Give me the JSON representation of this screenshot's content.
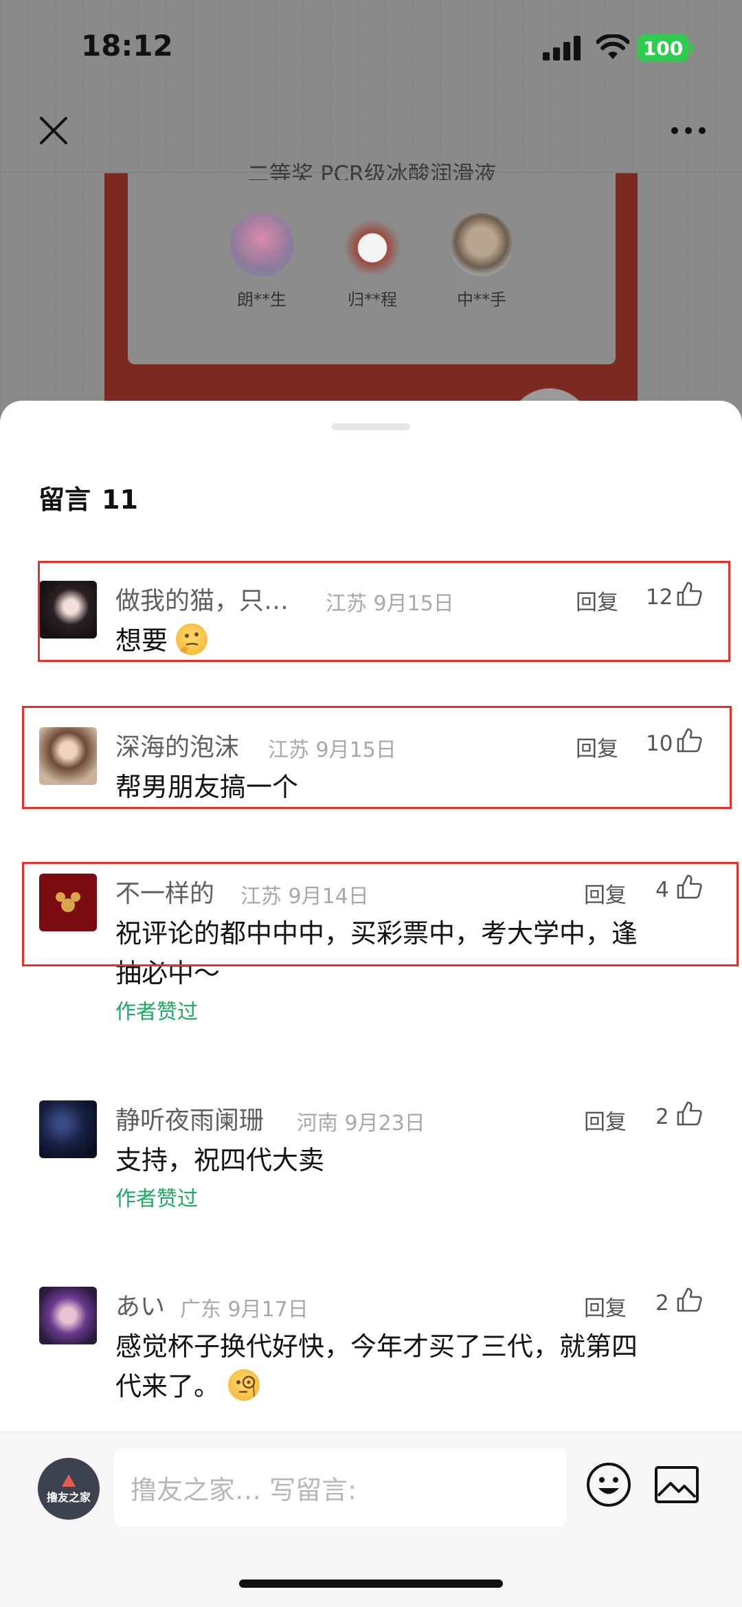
{
  "status_bar": {
    "time": "18:12",
    "battery": "100"
  },
  "background_page": {
    "card_heading": "二等奖 PCR级冰酸润滑液",
    "winners": [
      {
        "name": "朗**生"
      },
      {
        "name": "归**程"
      },
      {
        "name": "中**手"
      }
    ]
  },
  "sheet": {
    "title": "留言",
    "count": "11",
    "reply_label": "回复",
    "author_liked_label": "作者赞过",
    "comments": [
      {
        "name": "做我的猫，只…",
        "location": "江苏",
        "date": "9月15日",
        "likes": "12",
        "text": "想要",
        "emoji": "thinking-face"
      },
      {
        "name": "深海的泡沫",
        "location": "江苏",
        "date": "9月15日",
        "likes": "10",
        "text": "帮男朋友搞一个"
      },
      {
        "name": "不一样的",
        "location": "江苏",
        "date": "9月14日",
        "likes": "4",
        "text_line1": "祝评论的都中中中，买彩票中，考大学中，逢",
        "text_line2": "抽必中～",
        "author_liked": true
      },
      {
        "name": "静听夜雨阑珊",
        "location": "河南",
        "date": "9月23日",
        "likes": "2",
        "text": "支持，祝四代大卖",
        "author_liked": true
      },
      {
        "name": "あい",
        "location": "广东",
        "date": "9月17日",
        "likes": "2",
        "text_line1": "感觉杯子换代好快，今年才买了三代，就第四",
        "text_line2": "代来了。",
        "emoji": "monocle-face"
      }
    ]
  },
  "composer": {
    "avatar_text": "撸友之家",
    "placeholder": "撸友之家…   写留言:"
  },
  "colors": {
    "accent_green": "#1bab61",
    "highlight_red": "#e8302a",
    "battery_green": "#2fcd4f"
  }
}
